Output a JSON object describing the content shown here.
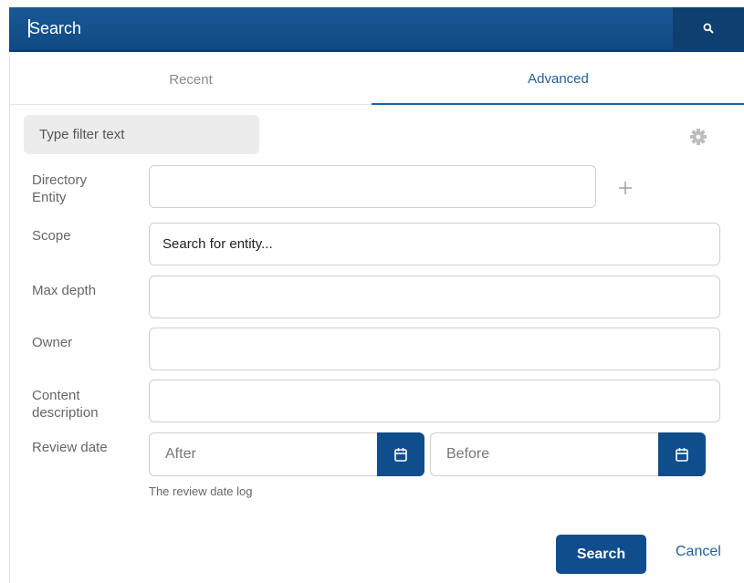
{
  "topbar": {
    "search_placeholder": "Search",
    "search_icon": "search-icon"
  },
  "tabs": [
    {
      "label": "Recent",
      "active": false
    },
    {
      "label": "Advanced",
      "active": true
    }
  ],
  "filter": {
    "placeholder": "Type filter text",
    "settings_icon": "gear-icon"
  },
  "form": {
    "directory_entity": {
      "label": "Directory Entity",
      "value": "",
      "add_icon": "plus-icon"
    },
    "scope": {
      "label": "Scope",
      "placeholder": "Search for entity..."
    },
    "max_depth": {
      "label": "Max depth",
      "value": ""
    },
    "owner": {
      "label": "Owner",
      "value": ""
    },
    "content_description": {
      "label": "Content description",
      "value": ""
    },
    "review_date": {
      "label": "Review date",
      "after_placeholder": "After",
      "before_placeholder": "Before",
      "calendar_icon": "calendar-icon",
      "hint": "The review date log"
    }
  },
  "actions": {
    "search_label": "Search",
    "cancel_label": "Cancel"
  },
  "colors": {
    "brand": "#104a85",
    "accent": "#1f5f9e"
  }
}
